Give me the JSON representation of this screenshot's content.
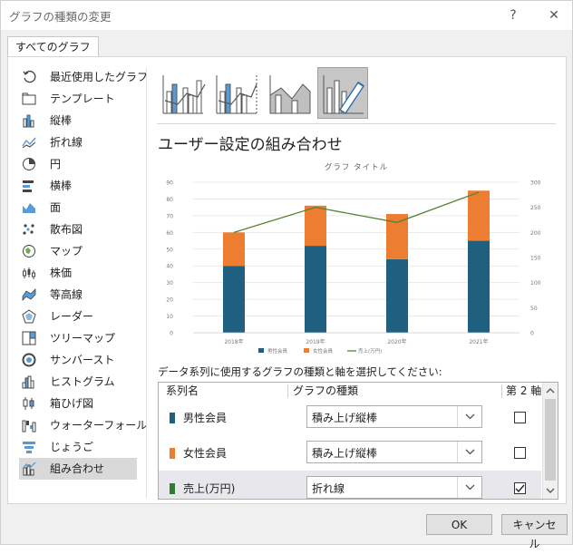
{
  "window": {
    "title": "グラフの種類の変更",
    "help_label": "?",
    "close_label": "✕"
  },
  "tabs": [
    {
      "label": "すべてのグラフ"
    }
  ],
  "sidebar": {
    "items": [
      {
        "label": "最近使用したグラフ",
        "icon": "recent-icon"
      },
      {
        "label": "テンプレート",
        "icon": "folder-icon"
      },
      {
        "label": "縦棒",
        "icon": "column-chart-icon"
      },
      {
        "label": "折れ線",
        "icon": "line-chart-icon"
      },
      {
        "label": "円",
        "icon": "pie-chart-icon"
      },
      {
        "label": "横棒",
        "icon": "bar-chart-icon"
      },
      {
        "label": "面",
        "icon": "area-chart-icon"
      },
      {
        "label": "散布図",
        "icon": "scatter-chart-icon"
      },
      {
        "label": "マップ",
        "icon": "map-chart-icon"
      },
      {
        "label": "株価",
        "icon": "stock-chart-icon"
      },
      {
        "label": "等高線",
        "icon": "surface-chart-icon"
      },
      {
        "label": "レーダー",
        "icon": "radar-chart-icon"
      },
      {
        "label": "ツリーマップ",
        "icon": "treemap-chart-icon"
      },
      {
        "label": "サンバースト",
        "icon": "sunburst-chart-icon"
      },
      {
        "label": "ヒストグラム",
        "icon": "histogram-chart-icon"
      },
      {
        "label": "箱ひげ図",
        "icon": "box-whisker-chart-icon"
      },
      {
        "label": "ウォーターフォール",
        "icon": "waterfall-chart-icon"
      },
      {
        "label": "じょうご",
        "icon": "funnel-chart-icon"
      },
      {
        "label": "組み合わせ",
        "icon": "combo-chart-icon",
        "selected": true
      }
    ]
  },
  "main": {
    "section_title": "ユーザー設定の組み合わせ",
    "instruction": "データ系列に使用するグラフの種類と軸を選択してください:"
  },
  "chart_data": {
    "type": "bar",
    "title": "グラフ タイトル",
    "categories": [
      "2018年",
      "2019年",
      "2020年",
      "2021年"
    ],
    "stacked": true,
    "series": [
      {
        "name": "男性会員",
        "type": "bar",
        "axis": "primary",
        "values": [
          40,
          52,
          44,
          55
        ],
        "color": "#1f5f7f"
      },
      {
        "name": "女性会員",
        "type": "bar",
        "axis": "primary",
        "values": [
          20,
          24,
          27,
          30
        ],
        "color": "#ed7d31"
      },
      {
        "name": "売上(万円)",
        "type": "line",
        "axis": "secondary",
        "values": [
          200,
          250,
          220,
          280
        ],
        "color": "#548235"
      }
    ],
    "ylim": [
      0,
      90
    ],
    "yticks": [
      "0",
      "10",
      "20",
      "30",
      "40",
      "50",
      "60",
      "70",
      "80",
      "90"
    ],
    "y2lim": [
      0,
      300
    ],
    "y2ticks": [
      "0",
      "50",
      "100",
      "150",
      "200",
      "250",
      "300"
    ],
    "legend": "bottom",
    "grid": true
  },
  "table": {
    "headers": {
      "name": "系列名",
      "type": "グラフの種類",
      "axis": "第 2 軸"
    },
    "rows": [
      {
        "name": "男性会員",
        "color": "#1f5f7f",
        "chart_type": "積み上げ縦棒",
        "secondary": false
      },
      {
        "name": "女性会員",
        "color": "#ed7d31",
        "chart_type": "積み上げ縦棒",
        "secondary": false
      },
      {
        "name": "売上(万円)",
        "color": "#2e7d32",
        "chart_type": "折れ線",
        "secondary": true,
        "selected": true
      }
    ]
  },
  "buttons": {
    "ok": "OK",
    "cancel": "キャンセル"
  }
}
